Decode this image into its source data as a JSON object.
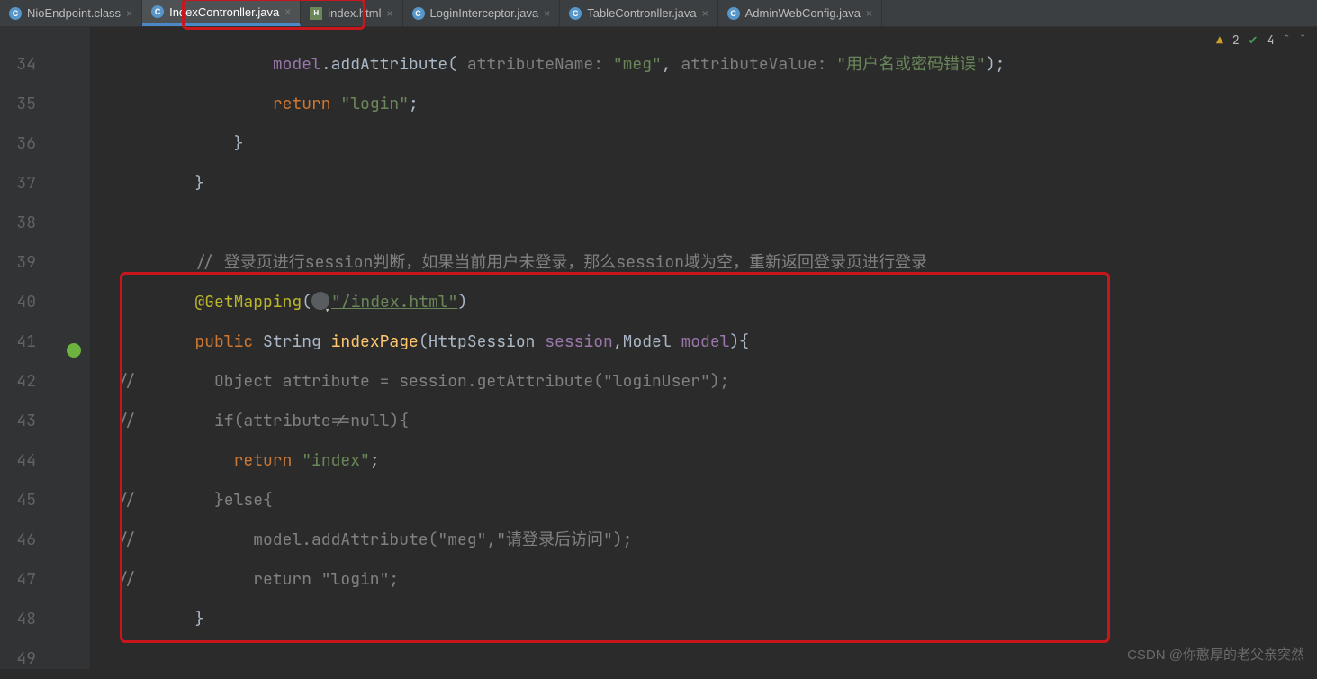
{
  "tabs": [
    {
      "label": "NioEndpoint.class",
      "icon": "c",
      "active": false
    },
    {
      "label": "IndexContronller.java",
      "icon": "c",
      "active": true
    },
    {
      "label": "index.html",
      "icon": "h",
      "active": false
    },
    {
      "label": "LoginInterceptor.java",
      "icon": "c",
      "active": false
    },
    {
      "label": "TableContronller.java",
      "icon": "c",
      "active": false
    },
    {
      "label": "AdminWebConfig.java",
      "icon": "c",
      "active": false
    }
  ],
  "inspections": {
    "warn": "2",
    "ok": "4"
  },
  "lines": {
    "34": {
      "num": "34"
    },
    "35": {
      "num": "35"
    },
    "36": {
      "num": "36"
    },
    "37": {
      "num": "37"
    },
    "38": {
      "num": "38"
    },
    "39": {
      "num": "39"
    },
    "40": {
      "num": "40"
    },
    "41": {
      "num": "41"
    },
    "42": {
      "num": "42"
    },
    "43": {
      "num": "43"
    },
    "44": {
      "num": "44"
    },
    "45": {
      "num": "45"
    },
    "46": {
      "num": "46"
    },
    "47": {
      "num": "47"
    },
    "48": {
      "num": "48"
    },
    "49": {
      "num": "49"
    }
  },
  "code": {
    "l34_a": "model",
    "l34_b": ".addAttribute( ",
    "l34_p1": "attributeName: ",
    "l34_s1": "\"meg\"",
    "l34_c": ", ",
    "l34_p2": "attributeValue: ",
    "l34_s2": "\"用户名或密码错误\"",
    "l34_d": ");",
    "l35_a": "return ",
    "l35_b": "\"login\"",
    "l35_c": ";",
    "l36": "}",
    "l37": "}",
    "l39_a": "// ",
    "l39_b": "登录页进行session判断，如果当前用户未登录，那么session域为空，重新返回登录页进行登录",
    "l40_a": "@GetMapping",
    "l40_b": "(",
    "l40_c": "\"/index.html\"",
    "l40_d": ")",
    "l41_a": "public ",
    "l41_b": "String ",
    "l41_c": "indexPage",
    "l41_d": "(HttpSession ",
    "l41_e": "session",
    "l41_f": ",Model ",
    "l41_g": "model",
    "l41_h": "){",
    "l42_a": "//",
    "l42_b": "        Object attribute = session.getAttribute(\"loginUser\");",
    "l43_a": "//",
    "l43_b": "        if(attribute!=null){",
    "l44_a": "return ",
    "l44_b": "\"index\"",
    "l44_c": ";",
    "l45_a": "//",
    "l45_b": "        }else{",
    "l46_a": "//",
    "l46_b": "            model.addAttribute(\"meg\",\"请登录后访问\");",
    "l47_a": "//",
    "l47_b": "            return \"login\";",
    "l48": "}"
  },
  "watermark": "CSDN @你憨厚的老父亲突然"
}
